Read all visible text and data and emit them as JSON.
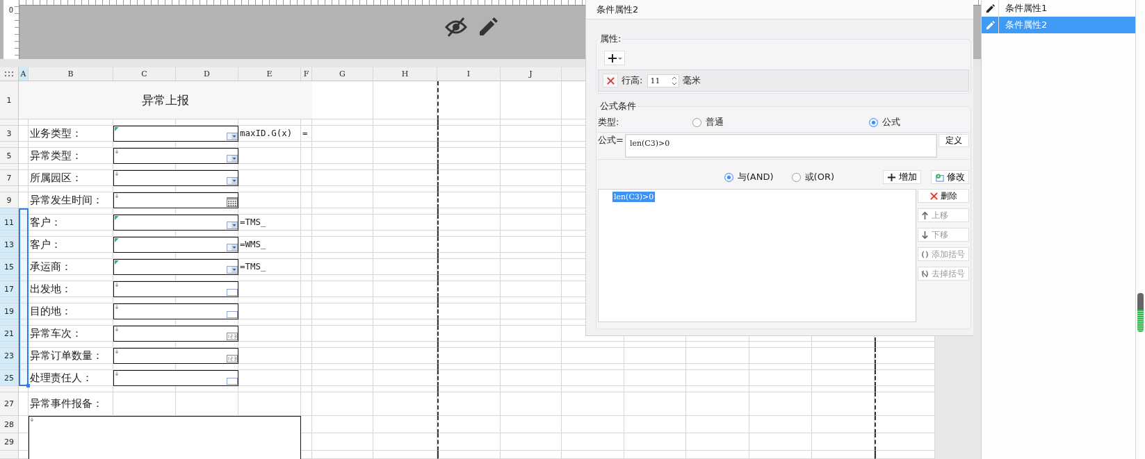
{
  "canvas": {
    "ruler_origin": "0"
  },
  "sheet": {
    "columns": [
      {
        "label": "A",
        "selected": true
      },
      {
        "label": "B",
        "selected": false
      },
      {
        "label": "C",
        "selected": false
      },
      {
        "label": "D",
        "selected": false
      },
      {
        "label": "E",
        "selected": false
      },
      {
        "label": "F",
        "selected": false
      },
      {
        "label": "G",
        "selected": false
      },
      {
        "label": "H",
        "selected": false
      },
      {
        "label": "I",
        "selected": false
      },
      {
        "label": "J",
        "selected": false
      }
    ],
    "rows": [
      {
        "label": "1",
        "selected": false
      },
      {
        "selected": false
      },
      {
        "label": "3",
        "selected": false
      },
      {
        "selected": false
      },
      {
        "label": "5",
        "selected": false
      },
      {
        "selected": false
      },
      {
        "label": "7",
        "selected": false
      },
      {
        "selected": false
      },
      {
        "label": "9",
        "selected": false
      },
      {
        "selected": true
      },
      {
        "label": "11",
        "selected": true
      },
      {
        "selected": true
      },
      {
        "label": "13",
        "selected": true
      },
      {
        "selected": true
      },
      {
        "label": "15",
        "selected": true
      },
      {
        "selected": true
      },
      {
        "label": "17",
        "selected": true
      },
      {
        "selected": true
      },
      {
        "label": "19",
        "selected": true
      },
      {
        "selected": true
      },
      {
        "label": "21",
        "selected": true
      },
      {
        "selected": true
      },
      {
        "label": "23",
        "selected": true
      },
      {
        "selected": true
      },
      {
        "label": "25",
        "selected": true
      },
      {
        "selected": false
      },
      {
        "label": "27",
        "selected": false
      },
      {
        "label": "28",
        "selected": false
      },
      {
        "label": "29",
        "selected": false
      }
    ],
    "title": "异常上报",
    "fields": [
      {
        "label": "业务类型：",
        "kind": "dropdown",
        "flagged": true,
        "note": "maxID.G(x)",
        "extra": "="
      },
      {
        "label": "异常类型：",
        "kind": "dropdown",
        "flagged": false
      },
      {
        "label": "所属园区：",
        "kind": "dropdown",
        "flagged": false
      },
      {
        "label": "异常发生时间：",
        "kind": "date",
        "flagged": false
      },
      {
        "label": "客户：",
        "kind": "dropdown",
        "flagged": true,
        "note": "=TMS_"
      },
      {
        "label": "客户：",
        "kind": "dropdown",
        "flagged": true,
        "note": "=WMS_"
      },
      {
        "label": "承运商：",
        "kind": "dropdown",
        "flagged": true,
        "note": "=TMS_"
      },
      {
        "label": "出发地：",
        "kind": "text",
        "flagged": false
      },
      {
        "label": "目的地：",
        "kind": "text",
        "flagged": false
      },
      {
        "label": "异常车次：",
        "kind": "number",
        "flagged": false
      },
      {
        "label": "异常订单数量：",
        "kind": "number",
        "flagged": false
      },
      {
        "label": "处理责任人：",
        "kind": "text",
        "flagged": false
      }
    ],
    "remarks_label": "异常事件报备："
  },
  "dialog": {
    "title": "条件属性2",
    "attributes": {
      "legend": "属性:",
      "label": "行高:",
      "value": "11",
      "unit": "毫米"
    },
    "formula": {
      "legend": "公式条件",
      "type_label": "类型:",
      "types": [
        {
          "label": "普通",
          "selected": false
        },
        {
          "label": "公式",
          "selected": true
        }
      ],
      "formula_label": "公式=",
      "formula_value": "len(C3)>0",
      "define_button": "定义",
      "joins": [
        {
          "label": "与(AND)",
          "selected": true
        },
        {
          "label": "或(OR)",
          "selected": false
        }
      ],
      "add_button": "增加",
      "modify_button": "修改",
      "conditions": [
        {
          "text": "len(C3)>0",
          "selected": true
        }
      ],
      "actions": [
        {
          "label": "删除",
          "kind": "delete",
          "disabled": false
        },
        {
          "label": "上移",
          "kind": "up",
          "disabled": true
        },
        {
          "label": "下移",
          "kind": "down",
          "disabled": true
        },
        {
          "label": "添加括号",
          "kind": "add_brackets",
          "disabled": true
        },
        {
          "label": "去掉括号",
          "kind": "remove_brackets",
          "disabled": true
        }
      ]
    }
  },
  "condition_list": [
    {
      "label": "条件属性1",
      "selected": false
    },
    {
      "label": "条件属性2",
      "selected": true
    }
  ]
}
